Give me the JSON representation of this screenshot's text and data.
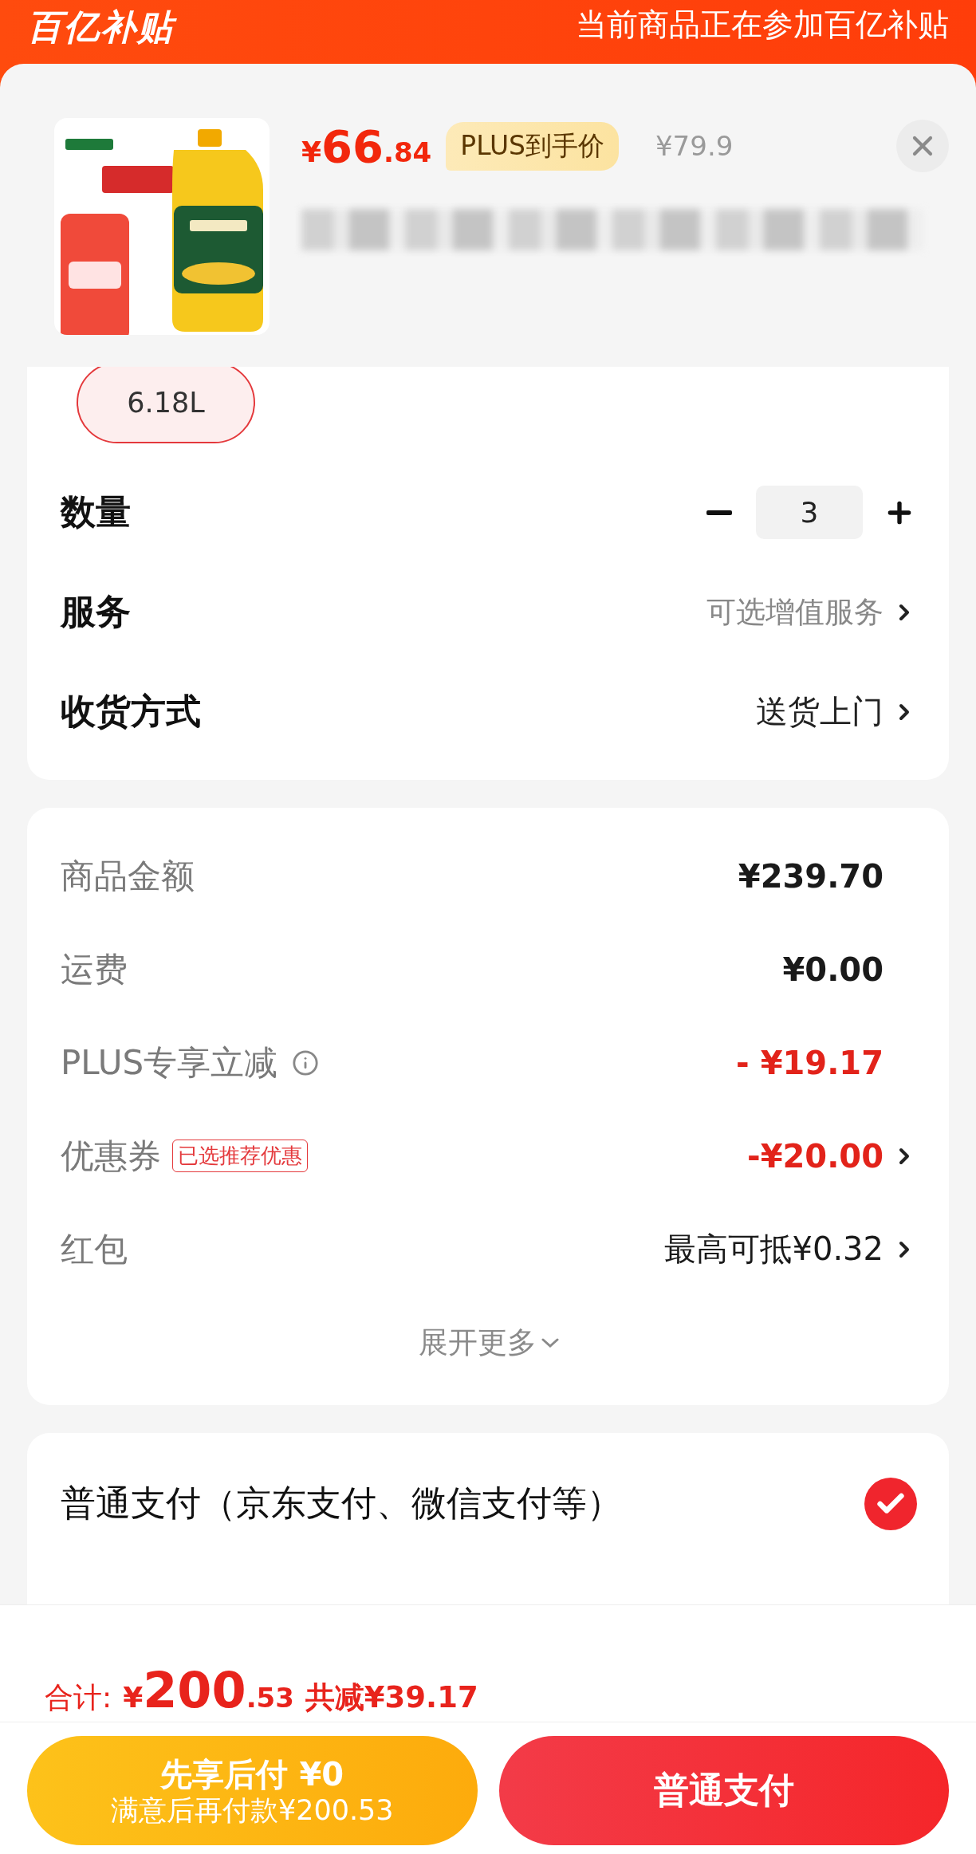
{
  "banner": {
    "logo": "百亿补贴",
    "notice": "当前商品正在参加百亿补贴"
  },
  "product": {
    "currency": "¥",
    "price_int": "66",
    "price_dec": ".84",
    "badge": "PLUS到手价",
    "original_price": "¥79.9"
  },
  "spec_chips": [
    {
      "label": "6.18L",
      "selected": true
    }
  ],
  "options": [
    {
      "kind": "stepper",
      "label": "数量",
      "value": "3"
    },
    {
      "kind": "link",
      "label": "服务",
      "value": "可选增值服务",
      "hint": true
    },
    {
      "kind": "link",
      "label": "收货方式",
      "value": "送货上门",
      "hint": false
    }
  ],
  "price_rows": [
    {
      "label": "商品金额",
      "value": "¥239.70",
      "discount": false,
      "strong": true,
      "chevron": false
    },
    {
      "label": "运费",
      "value": "¥0.00",
      "discount": false,
      "strong": true,
      "chevron": false
    },
    {
      "label": "PLUS专享立减",
      "info": true,
      "value": "- ¥19.17",
      "discount": true,
      "strong": true,
      "chevron": false
    },
    {
      "label": "优惠券",
      "tag": "已选推荐优惠",
      "value": "-¥20.00",
      "discount": true,
      "strong": true,
      "chevron": true
    },
    {
      "label": "红包",
      "value": "最高可抵¥0.32",
      "discount": false,
      "strong": false,
      "chevron": true
    }
  ],
  "expand": "展开更多",
  "payments": [
    {
      "label": "普通支付（京东支付、微信支付等）",
      "selected": true
    }
  ],
  "footer": {
    "total_label": "合计:",
    "currency": "¥",
    "total_int": "200",
    "total_dec": ".53",
    "saved": "共减¥39.17"
  },
  "buttons": [
    {
      "kind": "later",
      "title": "先享后付 ¥0",
      "subtitle": "满意后再付款¥200.53"
    },
    {
      "kind": "pay",
      "title": "普通支付"
    }
  ]
}
